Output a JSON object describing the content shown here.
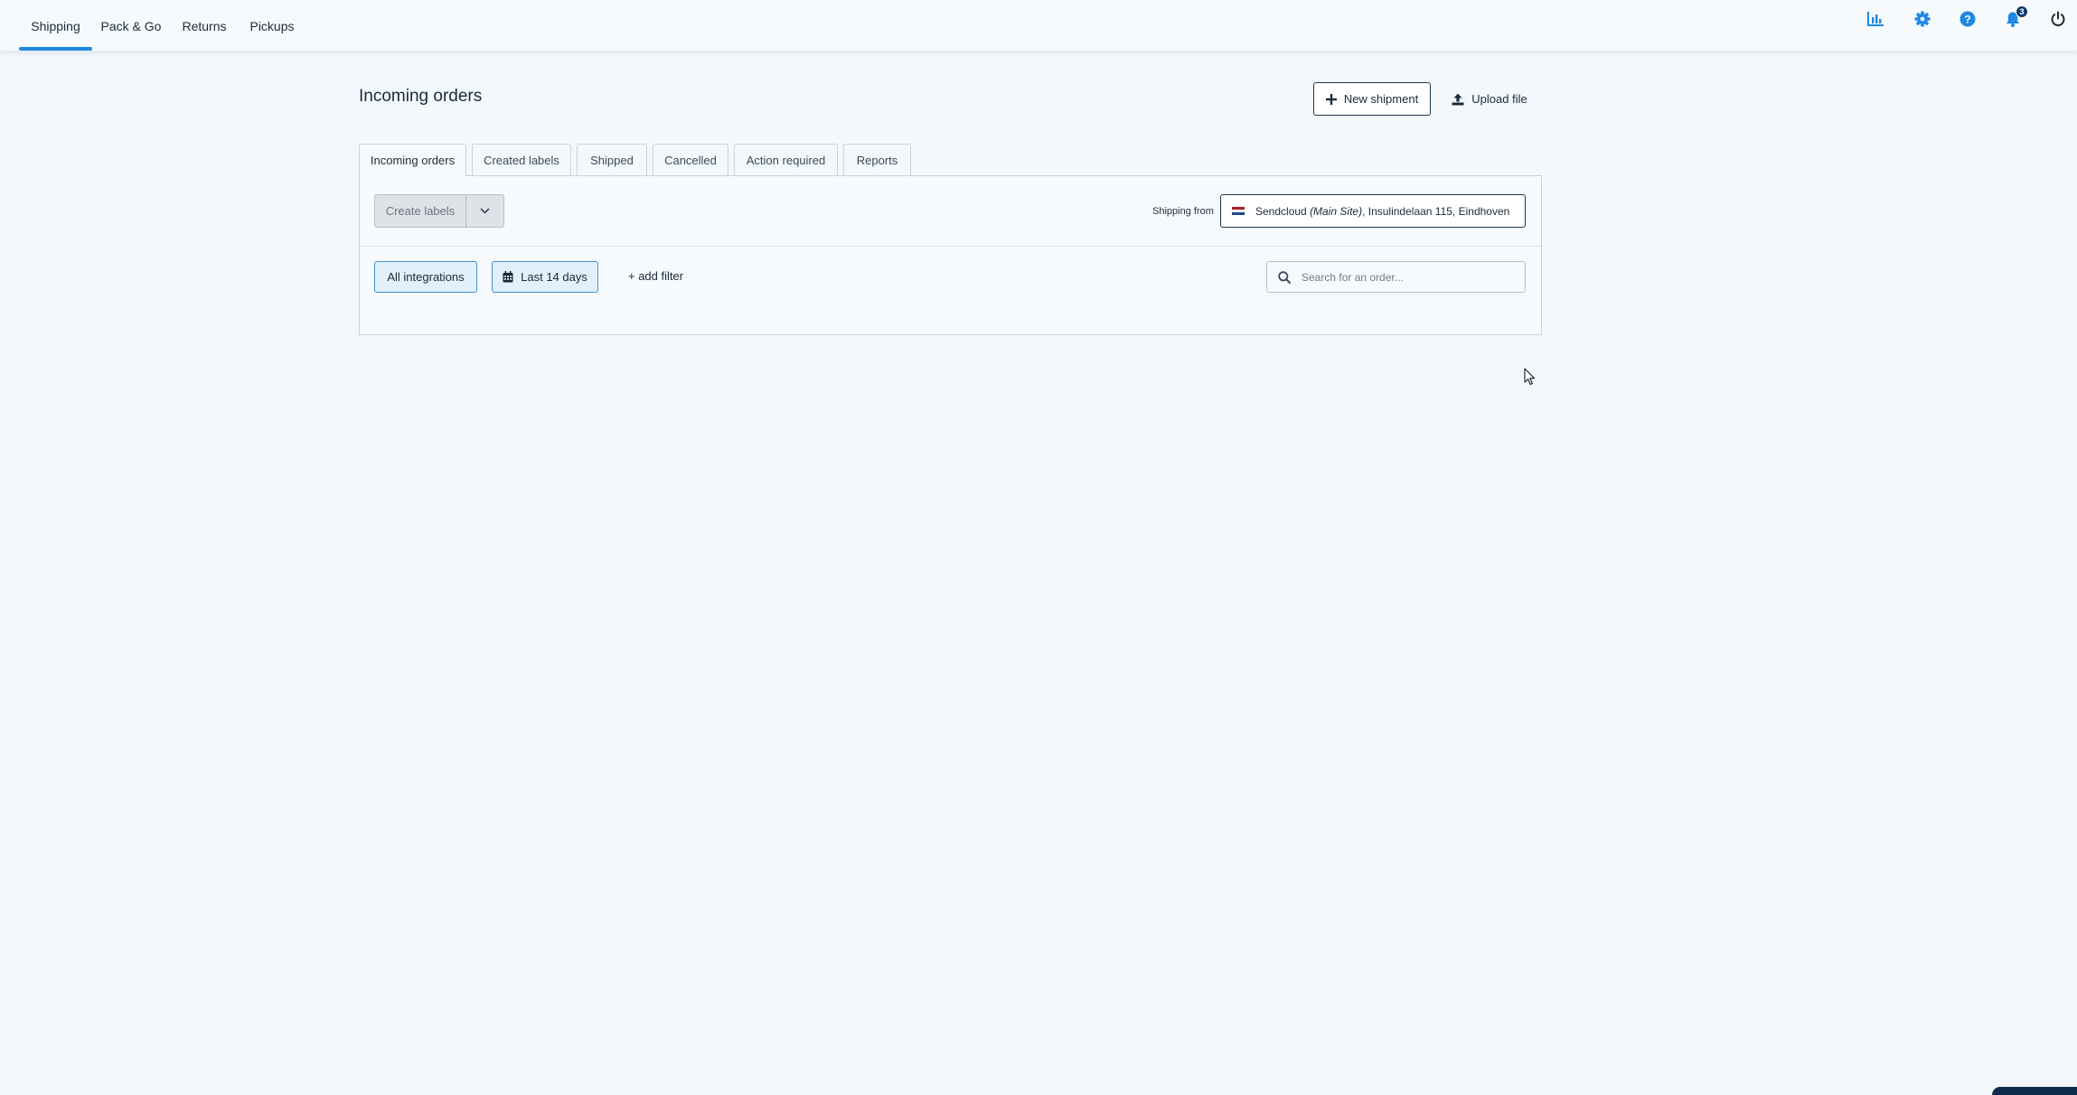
{
  "topnav": {
    "tabs": [
      {
        "label": "Shipping",
        "active": true
      },
      {
        "label": "Pack & Go",
        "active": false
      },
      {
        "label": "Returns",
        "active": false
      },
      {
        "label": "Pickups",
        "active": false
      }
    ],
    "icons": [
      "analytics-icon",
      "gear-icon",
      "help-icon",
      "bell-icon",
      "power-icon"
    ],
    "notification_count": "3"
  },
  "page": {
    "title": "Incoming orders",
    "new_shipment_label": "New shipment",
    "upload_file_label": "Upload file"
  },
  "tabs": [
    {
      "label": "Incoming orders",
      "active": true
    },
    {
      "label": "Created labels",
      "active": false
    },
    {
      "label": "Shipped",
      "active": false
    },
    {
      "label": "Cancelled",
      "active": false
    },
    {
      "label": "Action required",
      "active": false
    },
    {
      "label": "Reports",
      "active": false
    }
  ],
  "toolbar": {
    "create_labels_label": "Create labels",
    "shipping_from_label": "Shipping from",
    "shipping_from": {
      "name": "Sendcloud",
      "site": "(Main Site)",
      "address": ", Insulindelaan 115, Eindhoven"
    }
  },
  "filters": {
    "integrations_label": "All integrations",
    "date_range_label": "Last 14 days",
    "add_filter_label": "+ add filter",
    "search_placeholder": "Search for an order..."
  },
  "colors": {
    "accent": "#1e88e5",
    "brand_dark": "#1b3550",
    "background": "#f3f8fc",
    "notification_badge": "#0e3a6b"
  }
}
